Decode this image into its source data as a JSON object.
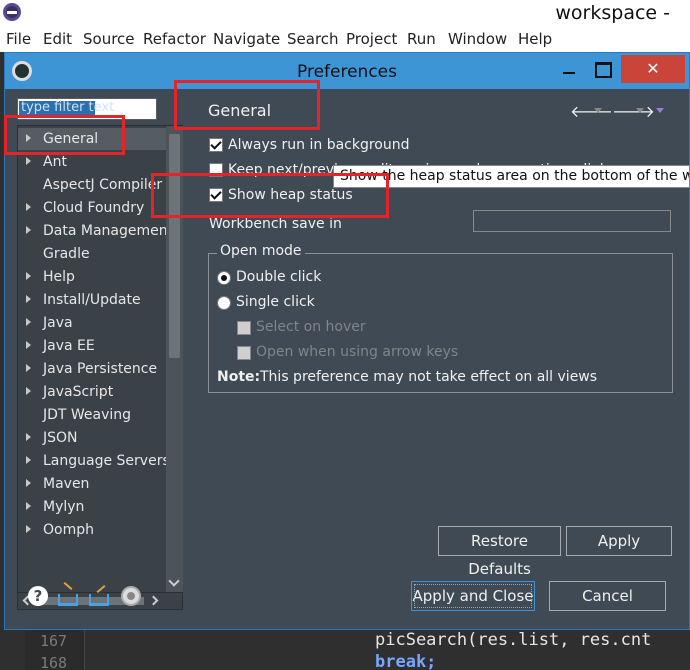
{
  "window": {
    "title": "workspace -"
  },
  "menu": [
    "File",
    "Edit",
    "Source",
    "Refactor",
    "Navigate",
    "Search",
    "Project",
    "Run",
    "Window",
    "Help"
  ],
  "editor": {
    "line_numbers": [
      "167",
      "168"
    ],
    "code_lines": [
      "picSearch(res.list, res.cnt",
      "break;"
    ]
  },
  "dialog": {
    "title": "Preferences",
    "close_glyph": "✕"
  },
  "filter": {
    "placeholder": "type filter text"
  },
  "tree": {
    "items": [
      {
        "label": "General",
        "expandable": true,
        "selected": true
      },
      {
        "label": "Ant",
        "expandable": true
      },
      {
        "label": "AspectJ Compiler",
        "expandable": false
      },
      {
        "label": "Cloud Foundry",
        "expandable": true
      },
      {
        "label": "Data Management",
        "expandable": true
      },
      {
        "label": "Gradle",
        "expandable": false
      },
      {
        "label": "Help",
        "expandable": true
      },
      {
        "label": "Install/Update",
        "expandable": true
      },
      {
        "label": "Java",
        "expandable": true
      },
      {
        "label": "Java EE",
        "expandable": true
      },
      {
        "label": "Java Persistence",
        "expandable": true
      },
      {
        "label": "JavaScript",
        "expandable": true
      },
      {
        "label": "JDT Weaving",
        "expandable": false
      },
      {
        "label": "JSON",
        "expandable": true
      },
      {
        "label": "Language Servers",
        "expandable": true
      },
      {
        "label": "Maven",
        "expandable": true
      },
      {
        "label": "Mylyn",
        "expandable": true
      },
      {
        "label": "Oomph",
        "expandable": true
      }
    ]
  },
  "page": {
    "title": "General",
    "nav_back": "🡐",
    "nav_forward": "🡒",
    "always_run_bg": {
      "label": "Always run in background",
      "checked": true
    },
    "keep_next_prev": {
      "label": "Keep next/previous editor, view and perspectives dialog open",
      "checked": false
    },
    "show_heap": {
      "label": "Show heap status",
      "checked": true
    },
    "workbench_save": {
      "label": "Workbench save in"
    },
    "tooltip": "Show the heap status area on the bottom of the wi",
    "open_mode": {
      "title": "Open mode",
      "double_click": {
        "label": "Double click",
        "selected": true
      },
      "single_click": {
        "label": "Single click",
        "selected": false
      },
      "select_on_hover": {
        "label": "Select on hover",
        "enabled": false
      },
      "open_arrow_keys": {
        "label": "Open when using arrow keys",
        "enabled": false
      },
      "note_bold": "Note:",
      "note_text": "This preference may not take effect on all views"
    }
  },
  "buttons": {
    "restore_defaults": "Restore Defaults",
    "apply": "Apply",
    "apply_and_close": "Apply and Close",
    "cancel": "Cancel"
  },
  "bottom_icons": [
    "help-icon",
    "import-icon",
    "export-icon",
    "record-icon"
  ],
  "colors": {
    "dialog_bg": "#3f4a55",
    "title_bar": "#3d95d6",
    "close_button": "#c9453a",
    "highlight": "#e3242b"
  }
}
